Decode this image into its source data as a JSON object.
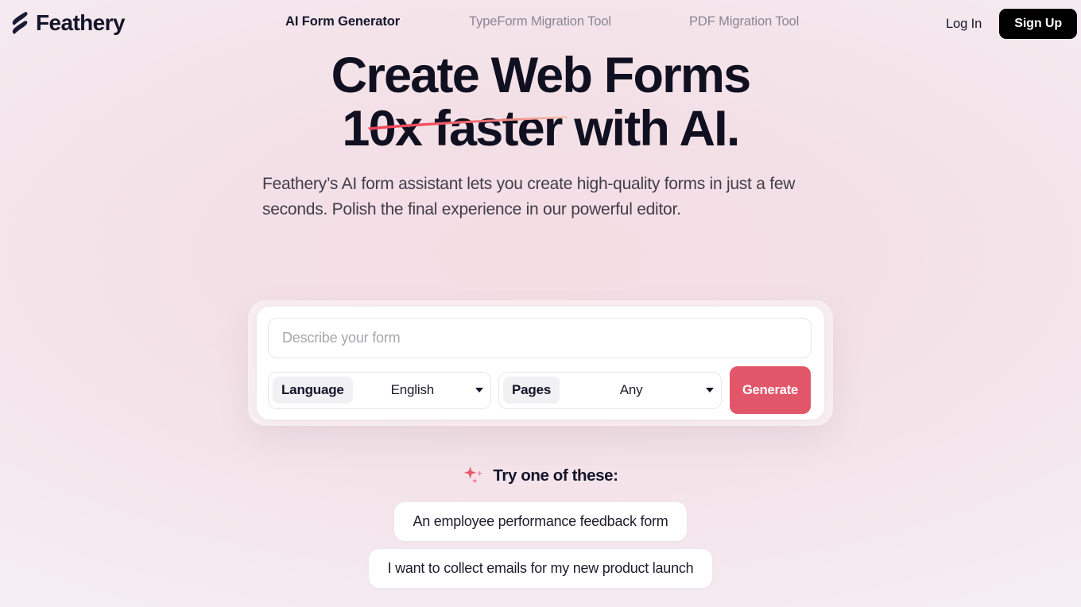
{
  "nav": {
    "brand": "Feathery",
    "brand_icon": "feather-logo-icon",
    "links": [
      {
        "label": "AI Form Generator",
        "active": true
      },
      {
        "label": "TypeForm Migration Tool",
        "active": false
      },
      {
        "label": "PDF Migration Tool",
        "active": false
      }
    ],
    "login_label": "Log In",
    "signup_label": "Sign Up"
  },
  "hero": {
    "title_line1": "Create Web Forms",
    "title_line2": "10x faster with AI.",
    "underline_color": "#ef4c5e",
    "subtitle": "Feathery’s AI form assistant lets you create high-quality forms in just a few seconds. Polish the final experience in our powerful editor."
  },
  "generator": {
    "input_placeholder": "Describe your form",
    "input_value": "",
    "language": {
      "label": "Language",
      "value": "English",
      "caret_icon": "chevron-down-icon"
    },
    "pages": {
      "label": "Pages",
      "value": "Any",
      "caret_icon": "chevron-down-icon"
    },
    "generate_label": "Generate",
    "generate_color": "#e2566a"
  },
  "suggestions": {
    "heading": "Try one of these:",
    "heading_icon": "sparkles-icon",
    "items": [
      "An employee performance feedback form",
      "I want to collect emails for my new product launch"
    ]
  }
}
